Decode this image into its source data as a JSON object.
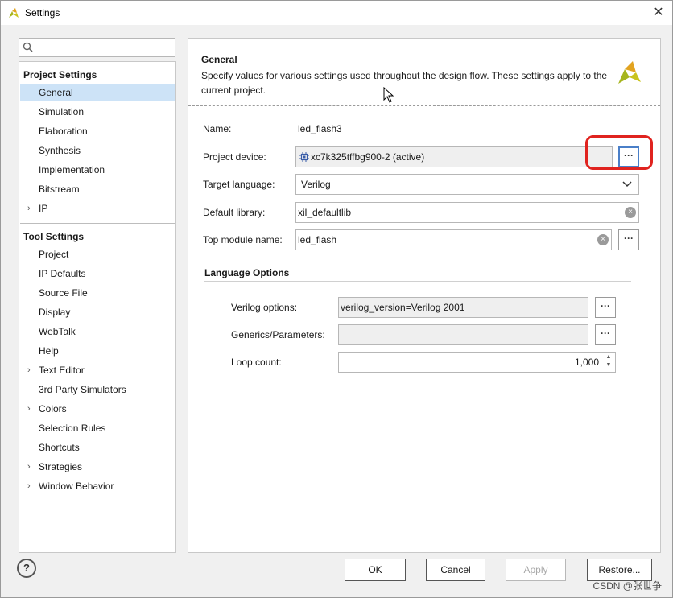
{
  "window": {
    "title": "Settings",
    "close_glyph": "✕"
  },
  "search": {
    "placeholder": ""
  },
  "tree": {
    "project_settings_label": "Project Settings",
    "project_items": [
      {
        "label": "General",
        "selected": true
      },
      {
        "label": "Simulation"
      },
      {
        "label": "Elaboration"
      },
      {
        "label": "Synthesis"
      },
      {
        "label": "Implementation"
      },
      {
        "label": "Bitstream"
      },
      {
        "label": "IP",
        "expandable": true
      }
    ],
    "tool_settings_label": "Tool Settings",
    "tool_items": [
      {
        "label": "Project"
      },
      {
        "label": "IP Defaults"
      },
      {
        "label": "Source File"
      },
      {
        "label": "Display"
      },
      {
        "label": "WebTalk"
      },
      {
        "label": "Help"
      },
      {
        "label": "Text Editor",
        "expandable": true
      },
      {
        "label": "3rd Party Simulators"
      },
      {
        "label": "Colors",
        "expandable": true
      },
      {
        "label": "Selection Rules"
      },
      {
        "label": "Shortcuts"
      },
      {
        "label": "Strategies",
        "expandable": true
      },
      {
        "label": "Window Behavior",
        "expandable": true
      }
    ]
  },
  "general": {
    "title": "General",
    "description": "Specify values for various settings used throughout the design flow. These settings apply to the current project.",
    "name_label": "Name:",
    "name_value": "led_flash3",
    "device_label": "Project device:",
    "device_value": "xc7k325tffbg900-2 (active)",
    "language_label": "Target language:",
    "language_value": "Verilog",
    "library_label": "Default library:",
    "library_value": "xil_defaultlib",
    "top_label": "Top module name:",
    "top_value": "led_flash",
    "dots": "···",
    "clear_glyph": "×"
  },
  "language_options": {
    "title": "Language Options",
    "verilog_label": "Verilog options:",
    "verilog_value": "verilog_version=Verilog 2001",
    "generics_label": "Generics/Parameters:",
    "generics_value": "",
    "loop_label": "Loop count:",
    "loop_value": "1,000"
  },
  "buttons": {
    "help": "?",
    "ok": "OK",
    "cancel": "Cancel",
    "apply": "Apply",
    "restore": "Restore..."
  },
  "watermark": "CSDN @张世争",
  "colors": {
    "selection": "#cde3f7",
    "highlight_ring": "#e0231f",
    "focus_border": "#4a7fc8"
  }
}
